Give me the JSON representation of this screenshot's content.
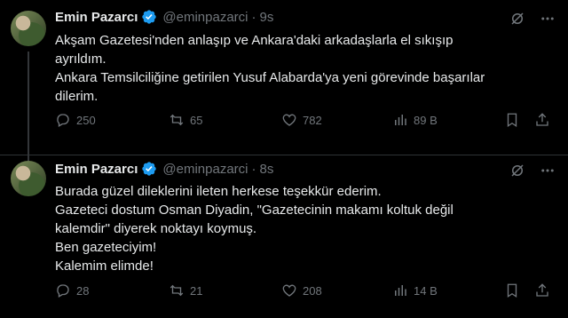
{
  "colors": {
    "background": "#000000",
    "text": "#e7e9ea",
    "muted": "#71767b",
    "verified": "#1d9bf0",
    "divider": "#2f3336"
  },
  "tweets": [
    {
      "name": "Emin Pazarcı",
      "handle": "@eminpazarci",
      "separator": "·",
      "time": "9s",
      "lines": [
        "Akşam Gazetesi'nden anlaşıp ve Ankara'daki arkadaşlarla el sıkışıp",
        "ayrıldım.",
        "Ankara Temsilciliğine getirilen Yusuf Alabarda'ya yeni görevinde başarılar",
        "dilerim."
      ],
      "replies": "250",
      "retweets": "65",
      "likes": "782",
      "views": "89 B"
    },
    {
      "name": "Emin Pazarcı",
      "handle": "@eminpazarci",
      "separator": "·",
      "time": "8s",
      "lines": [
        "Burada güzel dileklerini ileten herkese teşekkür ederim.",
        "Gazeteci dostum Osman Diyadin, \"Gazetecinin makamı koltuk değil",
        "kalemdir\" diyerek noktayı koymuş.",
        "Ben gazeteciyim!",
        "Kalemim elimde!"
      ],
      "replies": "28",
      "retweets": "21",
      "likes": "208",
      "views": "14 B"
    }
  ],
  "icons": [
    "verified-badge-icon",
    "grok-icon",
    "more-icon",
    "reply-icon",
    "retweet-icon",
    "like-icon",
    "views-icon",
    "bookmark-icon",
    "share-icon"
  ]
}
